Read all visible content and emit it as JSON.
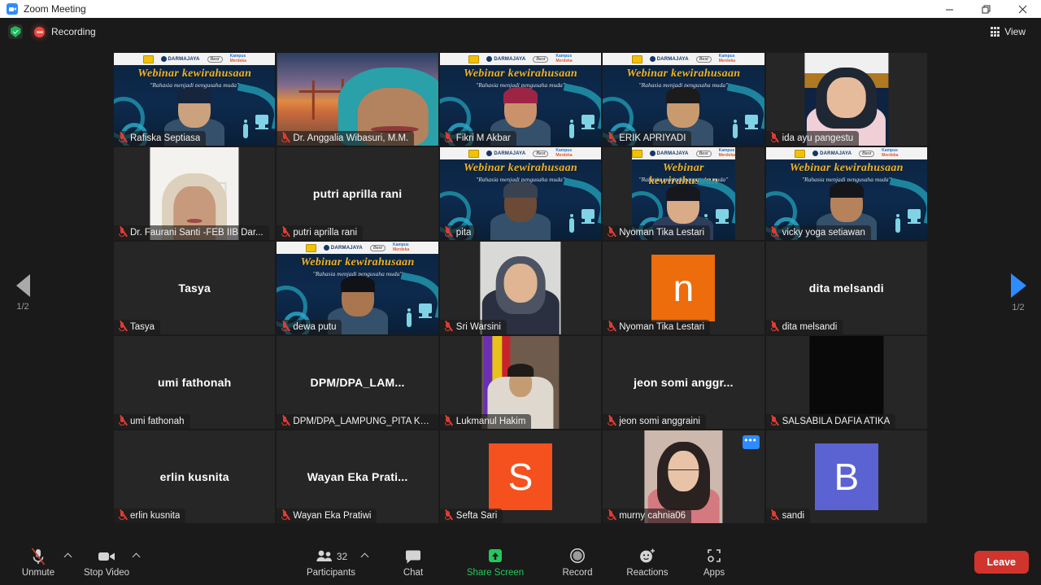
{
  "window": {
    "title": "Zoom Meeting",
    "app_icon": "zoom-video-icon",
    "minimize": "minimize-icon",
    "maximize": "restore-icon",
    "close": "close-icon"
  },
  "topbar": {
    "encryption_icon": "shield-check-icon",
    "recording_icon": "recording-dot-icon",
    "recording_label": "Recording",
    "view_icon": "grid-icon",
    "view_label": "View"
  },
  "pagination": {
    "prev_icon": "chevron-left-icon",
    "next_icon": "chevron-right-icon",
    "prev_label": "1/2",
    "next_label": "1/2",
    "prev_color": "#a9a9a9",
    "next_color": "#2d8cff"
  },
  "webinar_background": {
    "title": "Webinar kewirahusaan",
    "subtitle": "\"Rahasia menjadi pengusaha muda\"",
    "brand1": "DARMAJAYA",
    "brand2": "Best",
    "brand3": "Kampus",
    "brand3b": "Merdeka"
  },
  "gallery": {
    "active_speaker_color": "#c9e94a",
    "tiles": [
      {
        "name": "Rafiska Septiasa",
        "display": "Rafiska Septiasa",
        "kind": "webinar",
        "muted": true,
        "active": false,
        "skin": "#caa27e",
        "hair": "#16243c"
      },
      {
        "name": "Dr. Anggalia Wibasuri, M.M.",
        "display": "Dr. Anggalia Wibasuri, M.M.",
        "kind": "bridge",
        "muted": true,
        "active": false
      },
      {
        "name": "Fikri M Akbar",
        "display": "Fikri M Akbar",
        "kind": "webinar",
        "muted": true,
        "active": false,
        "skin": "#c9926a",
        "hair": "#9e2446"
      },
      {
        "name": "ERIK APRIYADI",
        "display": "ERIK APRIYADI",
        "kind": "webinar",
        "muted": true,
        "active": true,
        "skin": "#c99a6e",
        "hair": "#1b1b1b"
      },
      {
        "name": "ida ayu pangestu",
        "display": "ida ayu pangestu",
        "kind": "photo-hijab",
        "muted": true,
        "active": false
      },
      {
        "name": "Dr. Faurani Santi -FEB IIB Dar...",
        "display": "Dr. Faurani Santi -FEB IIB Dar...",
        "kind": "photo-white",
        "muted": true,
        "active": false
      },
      {
        "name": "putri aprilla rani",
        "display": "putri aprilla rani",
        "kind": "nameonly",
        "muted": true,
        "active": false
      },
      {
        "name": "pita",
        "display": "pita",
        "kind": "webinar",
        "muted": true,
        "active": false,
        "skin": "#6b4a38",
        "hair": "#3a4250"
      },
      {
        "name": "Nyoman Tika Lestari",
        "display": "Nyoman Tika Lestari",
        "kind": "webinar-narrow",
        "muted": true,
        "active": false
      },
      {
        "name": "vicky yoga setiawan",
        "display": "vicky yoga setiawan",
        "kind": "webinar",
        "muted": true,
        "active": false,
        "skin": "#b6825c",
        "hair": "#14161c"
      },
      {
        "name": "Tasya",
        "display": "Tasya",
        "kind": "nameonly",
        "muted": true,
        "active": false
      },
      {
        "name": "dewa putu",
        "display": "dewa putu",
        "kind": "webinar",
        "muted": true,
        "active": false,
        "skin": "#a9764f",
        "hair": "#101217"
      },
      {
        "name": "Sri Warsini",
        "display": "Sri Warsini",
        "kind": "photo-gray",
        "muted": true,
        "active": false
      },
      {
        "name": "Nyoman Tika Lestari",
        "display": "Nyoman Tika Lestari",
        "kind": "letter",
        "letter": "n",
        "color": "#ed6c0b",
        "muted": true,
        "active": false
      },
      {
        "name": "dita melsandi",
        "display": "dita melsandi",
        "kind": "nameonly",
        "muted": true,
        "active": false
      },
      {
        "name": "umi fathonah",
        "display": "umi fathonah",
        "kind": "nameonly",
        "muted": true,
        "active": false
      },
      {
        "name": "DPM/DPA_LAMPUNG_PITA KH...",
        "display": "DPM/DPA_LAM...",
        "kind": "nameonly",
        "muted": true,
        "active": false
      },
      {
        "name": "Lukmanul Hakim",
        "display": "Lukmanul Hakim",
        "kind": "photo-flag",
        "muted": true,
        "active": false
      },
      {
        "name": "jeon somi anggraini",
        "display": "jeon somi anggr...",
        "kind": "nameonly",
        "muted": true,
        "active": false
      },
      {
        "name": "SALSABILA DAFIA ATIKA",
        "display": "SALSABILA DAFIA ATIKA",
        "kind": "photo-black",
        "muted": true,
        "active": false
      },
      {
        "name": "erlin kusnita",
        "display": "erlin kusnita",
        "kind": "nameonly",
        "muted": true,
        "active": false
      },
      {
        "name": "Wayan Eka Pratiwi",
        "display": "Wayan Eka Prati...",
        "kind": "nameonly",
        "muted": true,
        "active": false
      },
      {
        "name": "Sefta Sari",
        "display": "Sefta Sari",
        "kind": "letter",
        "letter": "S",
        "color": "#f4511e",
        "muted": true,
        "active": false
      },
      {
        "name": "murny cahnia06",
        "display": "murny cahnia06",
        "kind": "photo-portrait",
        "muted": true,
        "active": false,
        "more_menu": "•••"
      },
      {
        "name": "sandi",
        "display": "sandi",
        "kind": "letter",
        "letter": "B",
        "color": "#5b63d3",
        "muted": true,
        "active": false
      }
    ]
  },
  "toolbar": {
    "mute": {
      "label": "Unmute",
      "icon": "microphone-muted-icon"
    },
    "video": {
      "label": "Stop Video",
      "icon": "video-camera-icon"
    },
    "participants": {
      "label": "Participants",
      "icon": "participants-icon",
      "count": "32"
    },
    "chat": {
      "label": "Chat",
      "icon": "chat-bubble-icon"
    },
    "share": {
      "label": "Share Screen",
      "icon": "share-screen-icon",
      "color": "#24c85a"
    },
    "record": {
      "label": "Record",
      "icon": "record-circle-icon"
    },
    "reactions": {
      "label": "Reactions",
      "icon": "smiley-plus-icon"
    },
    "apps": {
      "label": "Apps",
      "icon": "apps-bracket-icon"
    },
    "leave": {
      "label": "Leave",
      "color": "#d0342c"
    }
  }
}
